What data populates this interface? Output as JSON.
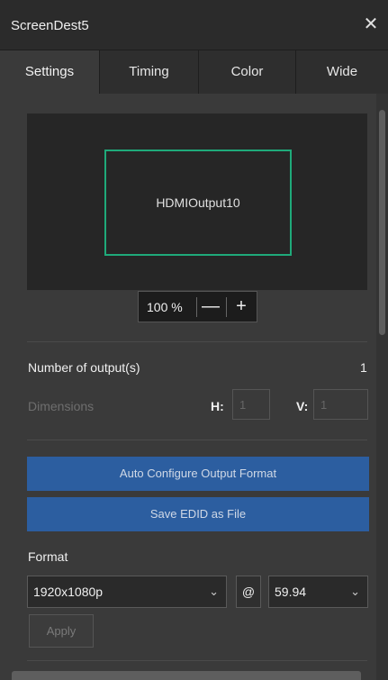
{
  "window": {
    "title": "ScreenDest5",
    "close_glyph": "✕"
  },
  "tabs": [
    {
      "label": "Settings",
      "active": true
    },
    {
      "label": "Timing",
      "active": false
    },
    {
      "label": "Color",
      "active": false
    },
    {
      "label": "Wide",
      "active": false
    }
  ],
  "preview": {
    "output_name": "HDMIOutput10",
    "zoom": "100 %",
    "zoom_out": "—",
    "zoom_in": "+",
    "rect_color": "#1faa7a"
  },
  "outputs": {
    "number_label": "Number of output(s)",
    "number_value": "1",
    "dimensions_label": "Dimensions",
    "h_label": "H:",
    "h_value": "1",
    "v_label": "V:",
    "v_value": "1"
  },
  "actions": {
    "auto_configure": "Auto Configure Output Format",
    "save_edid": "Save EDID as File",
    "button_color": "#2c5ea0"
  },
  "format": {
    "label": "Format",
    "resolution": "1920x1080p",
    "at": "@",
    "rate": "59.94",
    "chevron": "⌄",
    "apply": "Apply"
  }
}
